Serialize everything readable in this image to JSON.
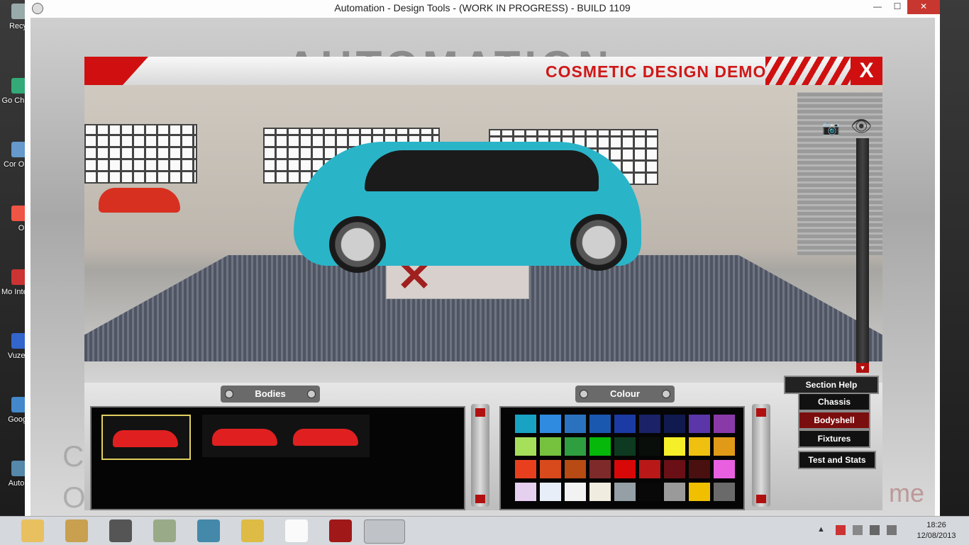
{
  "window": {
    "title": "Automation - Design Tools - (WORK IN PROGRESS) - BUILD 1109",
    "min": "—",
    "max": "☐",
    "close": "✕"
  },
  "desktop_icons": [
    "Recy",
    "Go Chr",
    "Cor Or",
    "Or",
    "Mo Intern",
    "Vuzel",
    "Goog",
    "Autor"
  ],
  "background": {
    "logo": "AUTOMATION",
    "letters": "C\nO",
    "suffix": "me"
  },
  "header": {
    "title": "COSMETIC DESIGN DEMO",
    "close": "X"
  },
  "viewport": {
    "camera_icon": "camera-icon",
    "eye_icon": "eye-icon",
    "hide_icon": "eye-off-icon",
    "up": "▲",
    "down": "▼"
  },
  "bodies": {
    "label": "Bodies",
    "selected_index": 0,
    "count": 3,
    "up": "▲",
    "down": "▼"
  },
  "colour": {
    "label": "Colour",
    "swatches": [
      "#18a3c4",
      "#2f8be0",
      "#2a72c0",
      "#1a58b0",
      "#1b3aa3",
      "#1b2268",
      "#101a4f",
      "#5a36a8",
      "#8a3aa8",
      "#a6e05a",
      "#76c23e",
      "#2f9e40",
      "#06b80a",
      "#0d3a20",
      "#0a0e0a",
      "#f5ef2a",
      "#f0c010",
      "#e09a18",
      "#e8401e",
      "#d84a1c",
      "#b84a14",
      "#7e2a2a",
      "#d80808",
      "#b81818",
      "#6a0f16",
      "#4a1010",
      "#e860e0",
      "#e6d0f0",
      "#e8eef8",
      "#f2f2f2",
      "#f0ede0",
      "#94a0a6",
      "#080808",
      "#9a9a9a",
      "#f0c000",
      "#6a6a6a"
    ],
    "up": "▲",
    "down": "▼"
  },
  "menu": {
    "help": "Section Help",
    "items": [
      "Chassis",
      "Bodyshell",
      "Fixtures",
      "Test and Stats"
    ],
    "active": 1
  },
  "taskbar": {
    "time": "18:26",
    "date": "12/08/2013",
    "tray_arrow": "▲"
  }
}
